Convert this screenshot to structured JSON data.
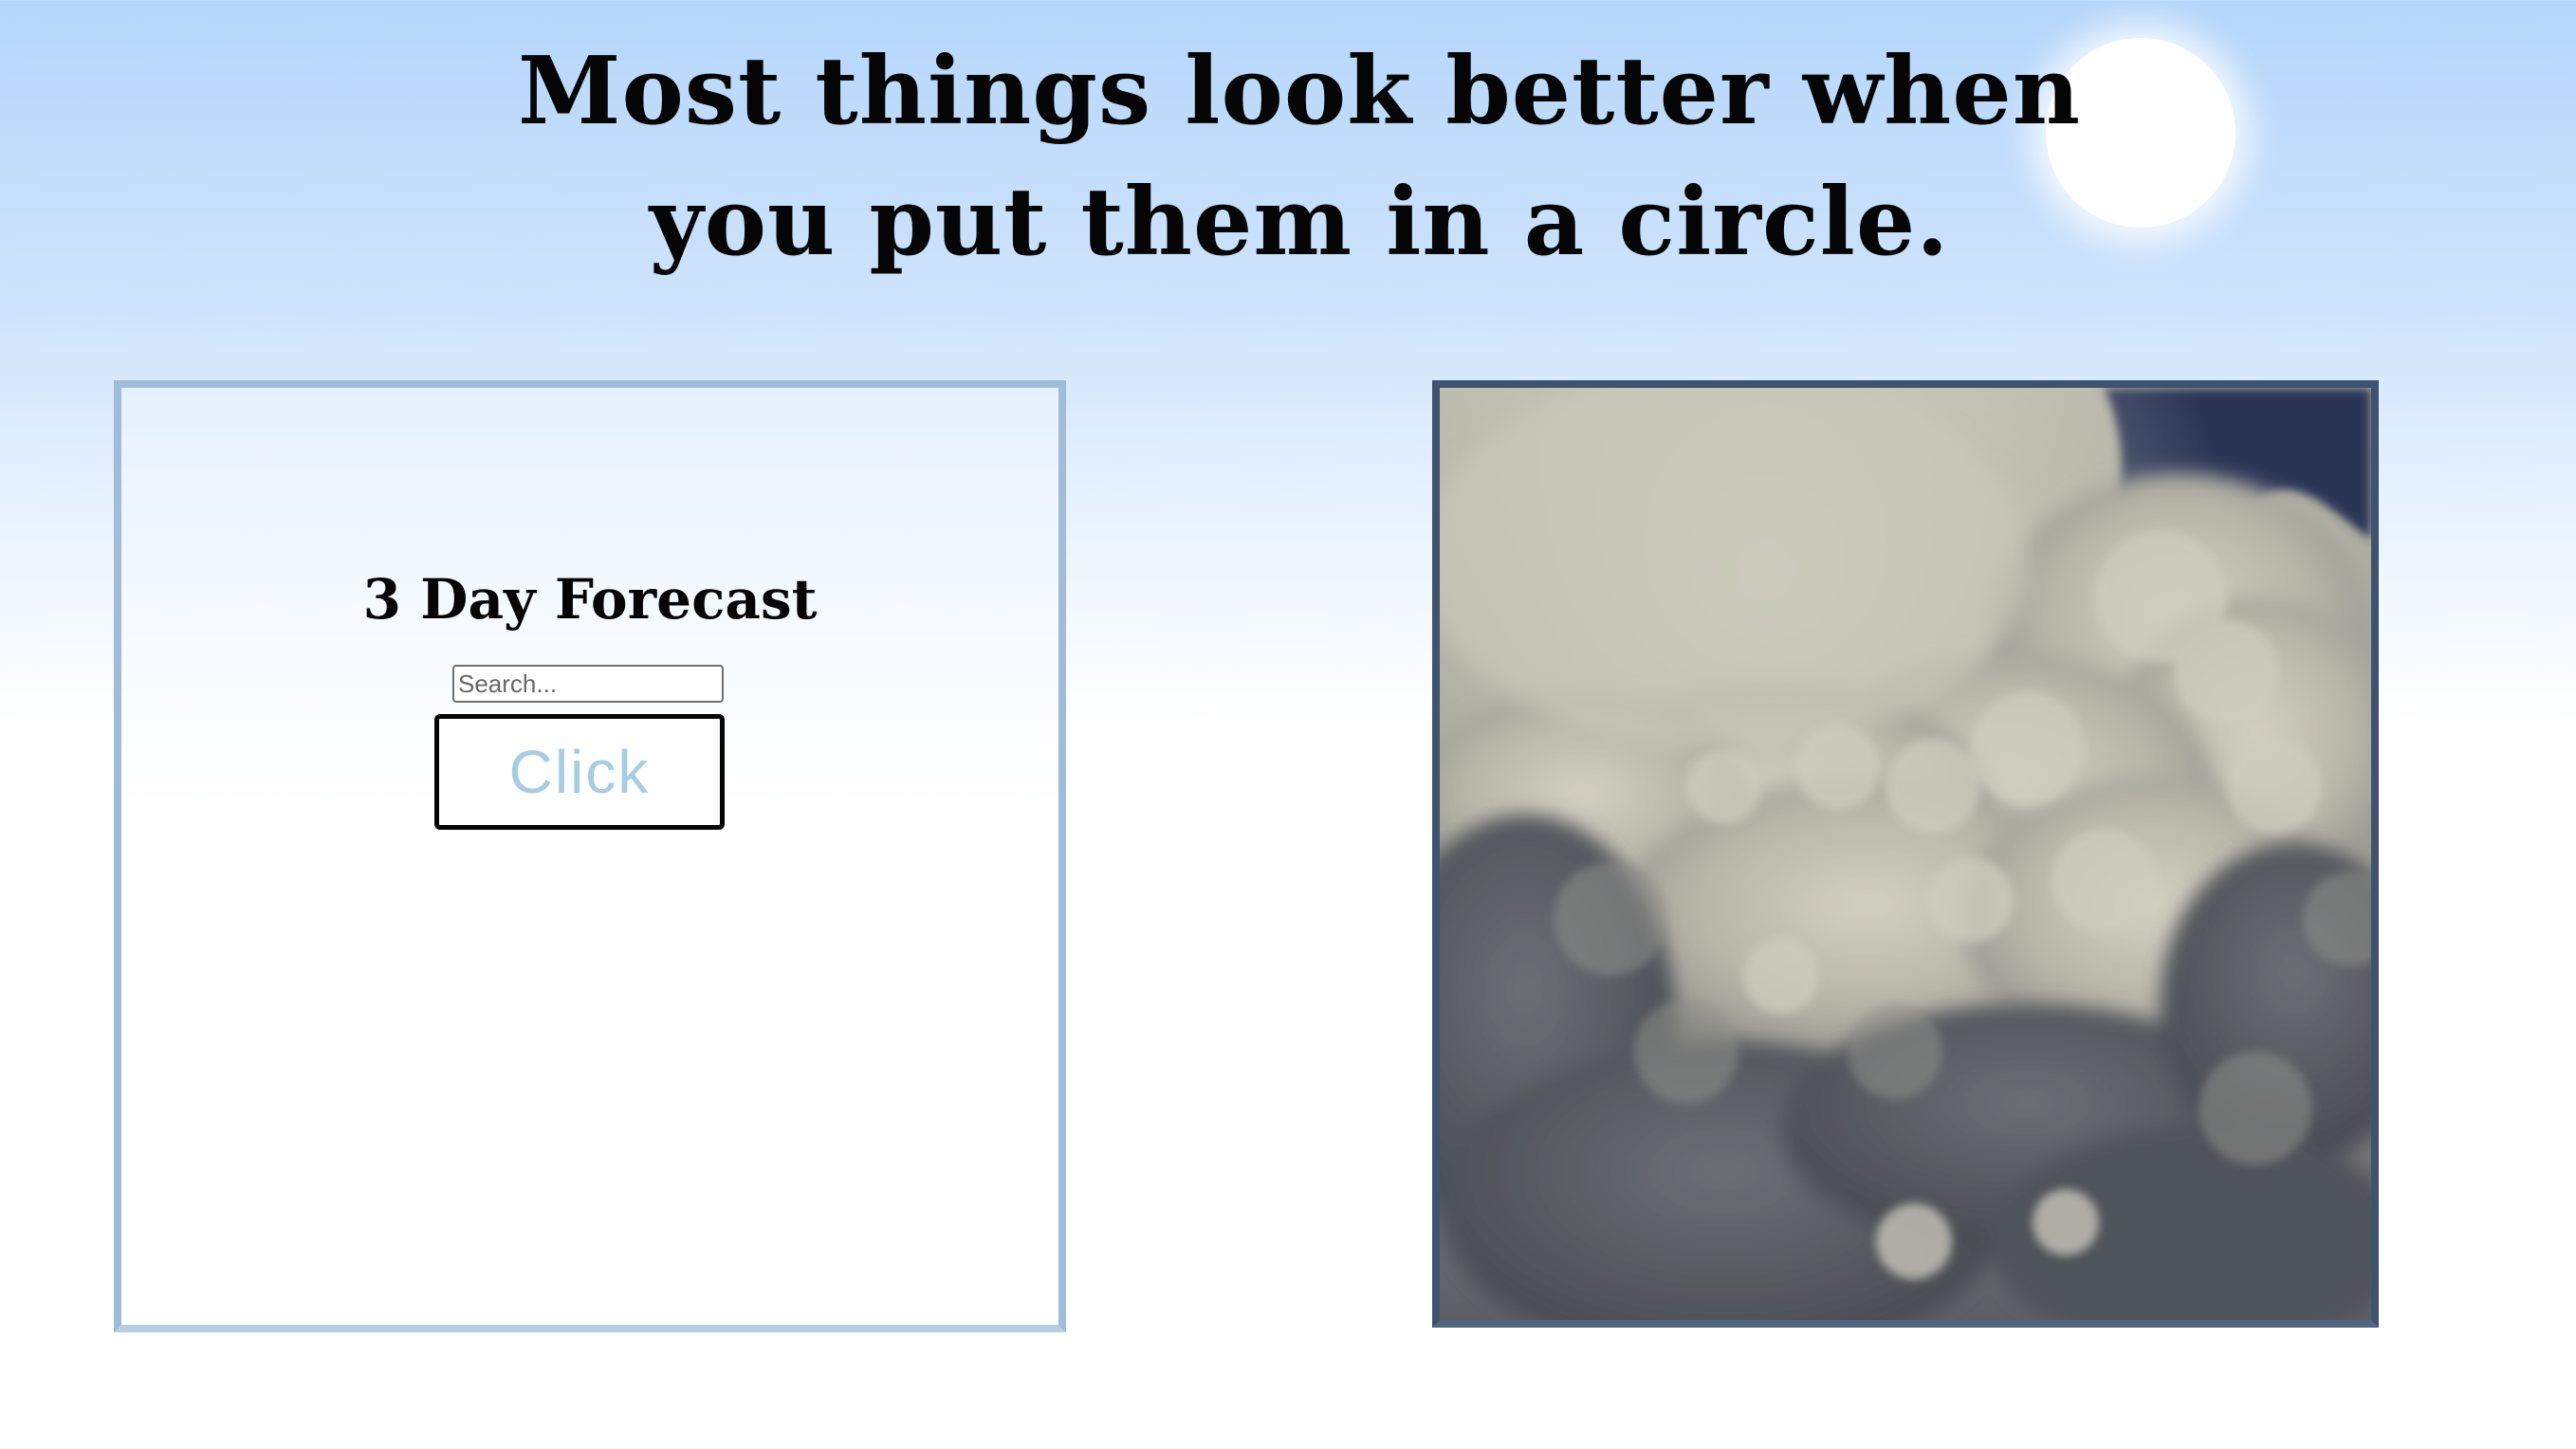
{
  "page": {
    "headline_line1": "Most things look better when",
    "headline_line2": "you put them in a circle."
  },
  "forecast": {
    "title": "3 Day Forecast",
    "search_placeholder": "Search...",
    "search_value": "",
    "button_label": "Click"
  },
  "colors": {
    "sky_top": "#b5d6fb",
    "panel_border": "#9fbdd8",
    "button_text": "#a7cce3",
    "image_border": "#3e5370"
  },
  "icons": {
    "sun": "sun-icon"
  }
}
